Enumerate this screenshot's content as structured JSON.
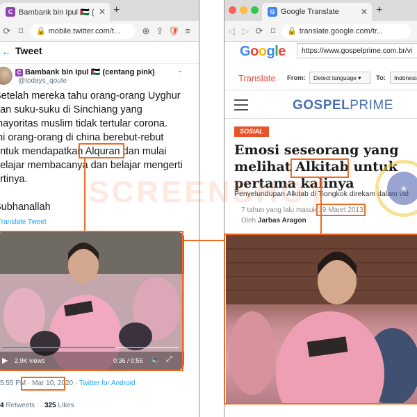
{
  "left_window": {
    "tab_title": "Bambank bin Ipul 🇵🇸 (centang",
    "url": "mobile.twitter.com/t...",
    "header_title": "Tweet",
    "author_name": "Bambank bin Ipul 🇵🇸 (centang pink)",
    "author_handle": "@todays_qoute",
    "tweet_lines": [
      "Setelah mereka tahu orang-orang Uyghur",
      "dan suku-suku di Sinchiang yang",
      "mayoritas muslim tidak tertular corona.",
      "Ini orang-orang di china berebut-rebut",
      "untuk mendapatkan",
      "Alquran",
      "dan mulai",
      "belajar membacanya dan belajar mengerti",
      "artinya."
    ],
    "tweet_closing": "Subhanallah",
    "translate_link": "Translate Tweet",
    "video_views": "2.9K views",
    "video_time": "0:36 / 0:56",
    "time_text": "5:55 PM",
    "separator": "·",
    "date_text": "Mar 10, 2020",
    "client_text": "Twitter for Android",
    "retweets_count": "4",
    "retweets_label": "Retweets",
    "likes_count": "325",
    "likes_label": "Likes"
  },
  "right_window": {
    "tab_title": "Google Translate",
    "url": "translate.google.com/tr...",
    "google_logo": "Google",
    "source_url": "https://www.gospelprime.com.br/vi",
    "translate_label": "Translate",
    "from_label": "From:",
    "from_value": "Detect language",
    "to_label": "To:",
    "to_value": "Indonesia",
    "site_logo_bold": "GOSPEL",
    "site_logo_light": "PRIME",
    "category_badge": "SOSIAL",
    "headline_line1": "Emosi seseorang yang",
    "headline_line2_before": "melihat",
    "headline_highlight": "Alkitab",
    "headline_line2_after": "untuk",
    "headline_line3": "pertama kalinya",
    "subheadline": "Penyelundupan Alkitab di Tiongkok direkam dalam vid",
    "date_prefix": "7 tahun yang lalu masuk",
    "date_text": "19 Maret 2013",
    "author_prefix": "Oleh",
    "author_name": "Jarbas Aragon"
  },
  "watermark": "SCREENSHOT",
  "colors": {
    "highlight": "#f26a21",
    "twitter_blue": "#1da1f2",
    "gospel_blue": "#4a6fb3",
    "badge_orange": "#e8542a"
  }
}
